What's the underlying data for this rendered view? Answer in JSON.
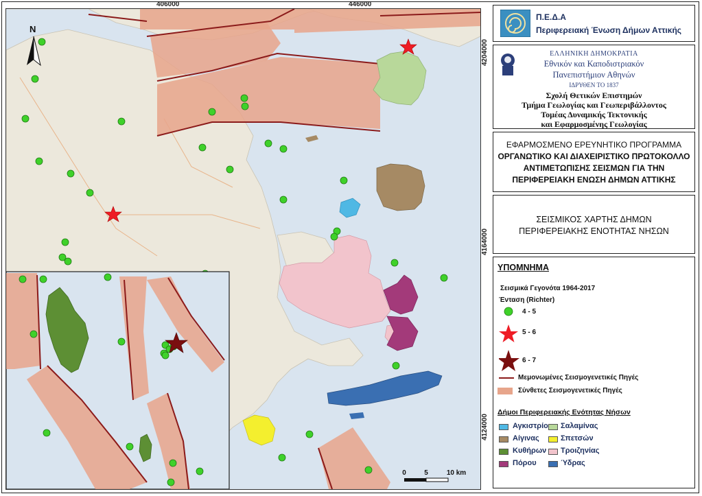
{
  "header": {
    "org_acronym": "Π.Ε.Δ.Α",
    "org_name": "Περιφερειακή Ένωση Δήμων Αττικής"
  },
  "university": {
    "republic": "ΕΛΛΗΝΙΚΗ ΔΗΜΟΚΡΑΤΙΑ",
    "name_line1": "Εθνικόν και Καποδιστριακόν",
    "name_line2": "Πανεπιστήμιον Αθηνών",
    "founded": "ΙΔΡΥΘΕΝ ΤΟ 1837",
    "school": "Σχολή Θετικών Επιστημών",
    "department": "Τμήμα Γεωλογίας και Γεωπεριβάλλοντος",
    "sector_line1": "Τομέας Δυναμικής Τεκτονικής",
    "sector_line2": "και Εφαρμοσμένης Γεωλογίας"
  },
  "program": {
    "line1": "ΕΦΑΡΜΟΣΜΕΝΟ ΕΡΕΥΝΗΤΙΚΟ ΠΡΟΓΡΑΜΜΑ",
    "line2": "ΟΡΓΑΝΩΤΙΚΟ ΚΑΙ ΔΙΑΧΕΙΡΙΣΤΙΚΟ ΠΡΩΤΟΚΟΛΛΟ",
    "line3": "ΑΝΤΙΜΕΤΩΠΙΣΗΣ ΣΕΙΣΜΩΝ ΓΙΑ ΤΗΝ",
    "line4": "ΠΕΡΙΦΕΡΕΙΑΚΗ ΕΝΩΣΗ ΔΗΜΩΝ ΑΤΤΙΚΗΣ"
  },
  "map_title": {
    "line1": "ΣΕΙΣΜΙΚΟΣ ΧΑΡΤΗΣ ΔΗΜΩΝ",
    "line2": "ΠΕΡΙΦΕΡΕΙΑΚΗΣ ΕΝΟΤΗΤΑΣ ΝΗΣΩΝ"
  },
  "map": {
    "north_label": "N",
    "x_ticks": [
      "406000",
      "446000"
    ],
    "y_ticks": [
      "4204000",
      "4164000",
      "4124000"
    ],
    "scale_labels": [
      "0",
      "5",
      "10 km"
    ],
    "colors": {
      "sea": "#d9e4ef",
      "land": "#ece8dc",
      "fault_zone": "#e7a58b",
      "fault_line": "#8b1a1a",
      "event_small": "#3fd12a",
      "event_medium": "#ee1c25",
      "event_large": "#7a0f0f"
    }
  },
  "legend": {
    "title": "ΥΠΟΜΝΗΜΑ",
    "events_heading": "Σεισμικά Γεγονότα 1964-2017",
    "intensity_heading": "Ένταση (Richter)",
    "mag_small": "4 - 5",
    "mag_medium": "5 - 6",
    "mag_large": "6 - 7",
    "fault_single": "Μεμονωμένες Σεισμογενετικές Πηγές",
    "fault_composite": "Σύνθετες Σεισμογενετικές Πηγές",
    "municipalities_heading": "Δήμοι Περιφερειακής Ενότητας Νήσων",
    "municipalities": [
      {
        "name": "Αγκιστρίου",
        "color": "#4fb8e4"
      },
      {
        "name": "Σαλαμίνας",
        "color": "#b8d89a"
      },
      {
        "name": "Αίγινας",
        "color": "#a68a64"
      },
      {
        "name": "Σπετσών",
        "color": "#f4ef2e"
      },
      {
        "name": "Κυθήρων",
        "color": "#5d8f34"
      },
      {
        "name": "Τροιζηνίας",
        "color": "#f2c4cc"
      },
      {
        "name": "Πόρου",
        "color": "#a33a7a"
      },
      {
        "name": "Ύδρας",
        "color": "#3a6fb2"
      }
    ]
  }
}
